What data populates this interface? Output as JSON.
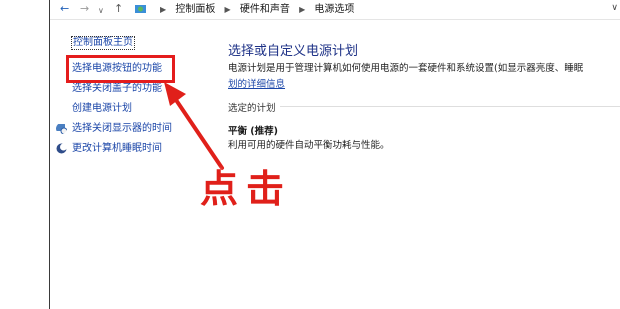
{
  "address_bar": {
    "back_icon": "back-arrow-icon",
    "forward_icon": "forward-arrow-icon",
    "up_icon": "up-arrow-icon",
    "breadcrumbs": [
      "控制面板",
      "硬件和声音",
      "电源选项"
    ]
  },
  "sidebar": {
    "home_label": "控制面板主页",
    "items": [
      {
        "label": "选择电源按钮的功能",
        "icon": null
      },
      {
        "label": "选择关闭盖子的功能",
        "icon": null
      },
      {
        "label": "创建电源计划",
        "icon": null
      },
      {
        "label": "选择关闭显示器的时间",
        "icon": "display-clock-icon"
      },
      {
        "label": "更改计算机睡眠时间",
        "icon": "moon-icon"
      }
    ]
  },
  "main": {
    "title": "选择或自定义电源计划",
    "description": "电源计划是用于管理计算机如何使用电源的一套硬件和系统设置(如显示器亮度、睡眠",
    "description_link": "划的详细信息",
    "section_label": "选定的计划",
    "plan_name": "平衡 (推荐)",
    "plan_description": "利用可用的硬件自动平衡功耗与性能。"
  },
  "annotation": {
    "text": "点击",
    "color": "#e0201a"
  }
}
